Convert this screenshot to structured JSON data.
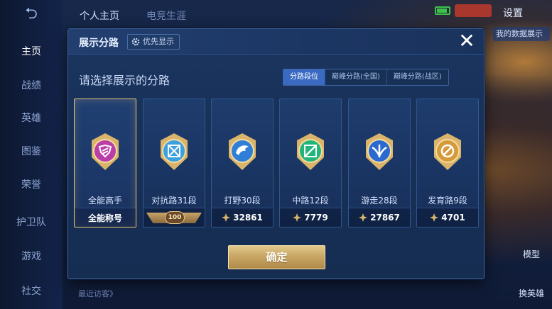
{
  "sidebar": {
    "back_icon": "back-arrow-icon",
    "items": [
      {
        "label": "主页",
        "active": true
      },
      {
        "label": "战绩",
        "active": false
      },
      {
        "label": "英雄",
        "active": false
      },
      {
        "label": "图鉴",
        "active": false
      },
      {
        "label": "荣誉",
        "active": false
      },
      {
        "label": "护卫队",
        "active": false
      },
      {
        "label": "游戏",
        "active": false
      },
      {
        "label": "社交",
        "active": false
      }
    ]
  },
  "topbar": {
    "tabs": [
      "个人主页",
      "电竞生涯"
    ],
    "settings_label": "设置",
    "right_tag": "我的数据展示"
  },
  "background": {
    "right_labels": [
      "模型",
      "换英雄"
    ],
    "bottom_text": "最近访客》"
  },
  "modal": {
    "title": "展示分路",
    "priority_chip": "优先显示",
    "select_prompt": "请选择展示的分路",
    "tabs": [
      {
        "label": "分路段位",
        "active": true
      },
      {
        "label": "巅峰分路(全国)",
        "active": false
      },
      {
        "label": "巅峰分路(战区)",
        "active": false
      }
    ],
    "cards": [
      {
        "title": "全能高手",
        "footer": "全能称号",
        "badge": "all-round-badge-icon",
        "color": "#b93ea8",
        "selected": true,
        "footer_type": "text"
      },
      {
        "title": "对抗路31段",
        "footer": "100",
        "badge": "clash-lane-badge-icon",
        "color": "#3aa0e0",
        "selected": false,
        "footer_type": "rank"
      },
      {
        "title": "打野30段",
        "footer": "32861",
        "badge": "jungle-badge-icon",
        "color": "#2f7fd8",
        "selected": false,
        "footer_type": "points"
      },
      {
        "title": "中路12段",
        "footer": "7779",
        "badge": "mid-lane-badge-icon",
        "color": "#22b57a",
        "selected": false,
        "footer_type": "points"
      },
      {
        "title": "游走28段",
        "footer": "27867",
        "badge": "roam-badge-icon",
        "color": "#2a6ad0",
        "selected": false,
        "footer_type": "points"
      },
      {
        "title": "发育路9段",
        "footer": "4701",
        "badge": "farm-lane-badge-icon",
        "color": "#d69a3a",
        "selected": false,
        "footer_type": "points"
      }
    ],
    "confirm_label": "确定"
  }
}
